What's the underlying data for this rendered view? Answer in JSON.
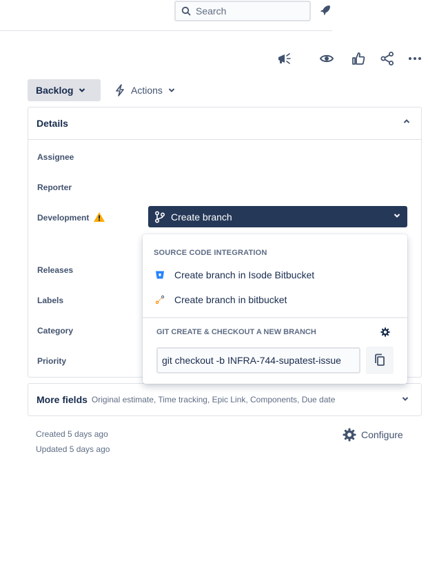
{
  "search": {
    "placeholder": "Search"
  },
  "status": {
    "label": "Backlog"
  },
  "actions": {
    "label": "Actions"
  },
  "details": {
    "title": "Details",
    "fields": {
      "assignee": "Assignee",
      "reporter": "Reporter",
      "development": "Development",
      "releases": "Releases",
      "labels": "Labels",
      "category": "Category",
      "priority": "Priority"
    }
  },
  "create_branch": {
    "label": "Create branch"
  },
  "dropdown": {
    "source_heading": "SOURCE CODE INTEGRATION",
    "items": [
      {
        "label": "Create branch in Isode Bitbucket",
        "icon": "bitbucket-icon"
      },
      {
        "label": "Create branch in bitbucket",
        "icon": "git-branch-icon"
      }
    ],
    "git_heading": "GIT CREATE & CHECKOUT A NEW BRANCH",
    "git_command": "git checkout -b INFRA-744-supatest-issue"
  },
  "more_fields": {
    "title": "More fields",
    "summary": "Original estimate, Time tracking, Epic Link, Components, Due date"
  },
  "meta": {
    "created": "Created 5 days ago",
    "updated": "Updated 5 days ago"
  },
  "configure": {
    "label": "Configure"
  },
  "colors": {
    "primary_dark": "#253858",
    "warning": "#ffab00",
    "bitbucket_blue": "#2684ff",
    "text": "#172b4d"
  }
}
